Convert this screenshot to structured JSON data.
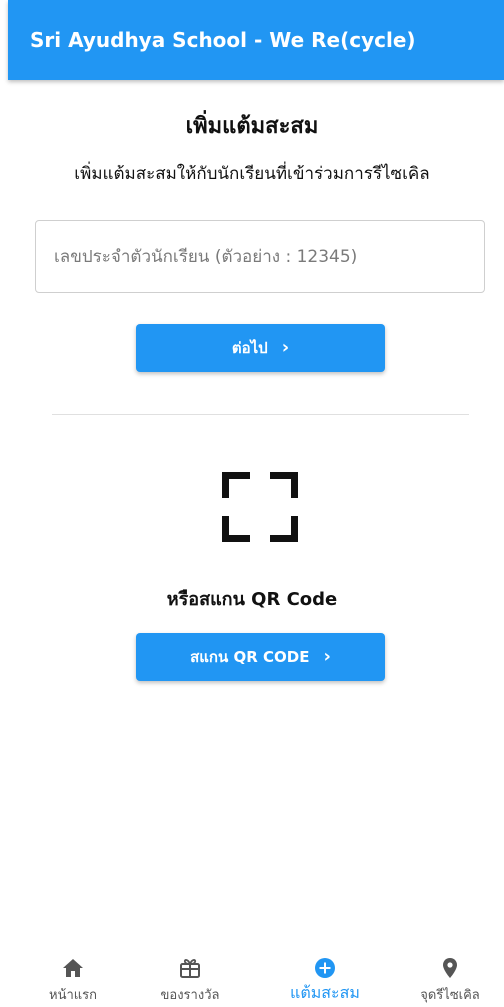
{
  "appbar": {
    "title": "Sri Ayudhya School - We Re(cycle)"
  },
  "page": {
    "title": "เพิ่มแต้มสะสม",
    "subtitle": "เพิ่มแต้มสะสมให้กับนักเรียนที่เข้าร่วมการรีไซเคิล"
  },
  "form": {
    "student_id_value": "",
    "student_id_placeholder": "เลขประจำตัวนักเรียน (ตัวอย่าง : 12345)",
    "next_label": "ต่อไป",
    "next_icon": "chevron-right-icon"
  },
  "qr": {
    "icon": "qr-scan-frame-icon",
    "label": "หรือสแกน QR Code",
    "scan_label": "สแกน QR CODE",
    "scan_icon": "chevron-right-icon"
  },
  "bottom_nav": {
    "items": [
      {
        "label": "หน้าแรก",
        "icon": "home-icon",
        "active": false
      },
      {
        "label": "ของรางวัล",
        "icon": "gift-icon",
        "active": false
      },
      {
        "label": "แต้มสะสม",
        "icon": "add-circle-icon",
        "active": true
      },
      {
        "label": "จุดรีไซเคิล",
        "icon": "location-pin-icon",
        "active": false
      }
    ]
  },
  "colors": {
    "primary": "#2196f3",
    "text": "#111111",
    "nav_inactive": "#555555"
  }
}
